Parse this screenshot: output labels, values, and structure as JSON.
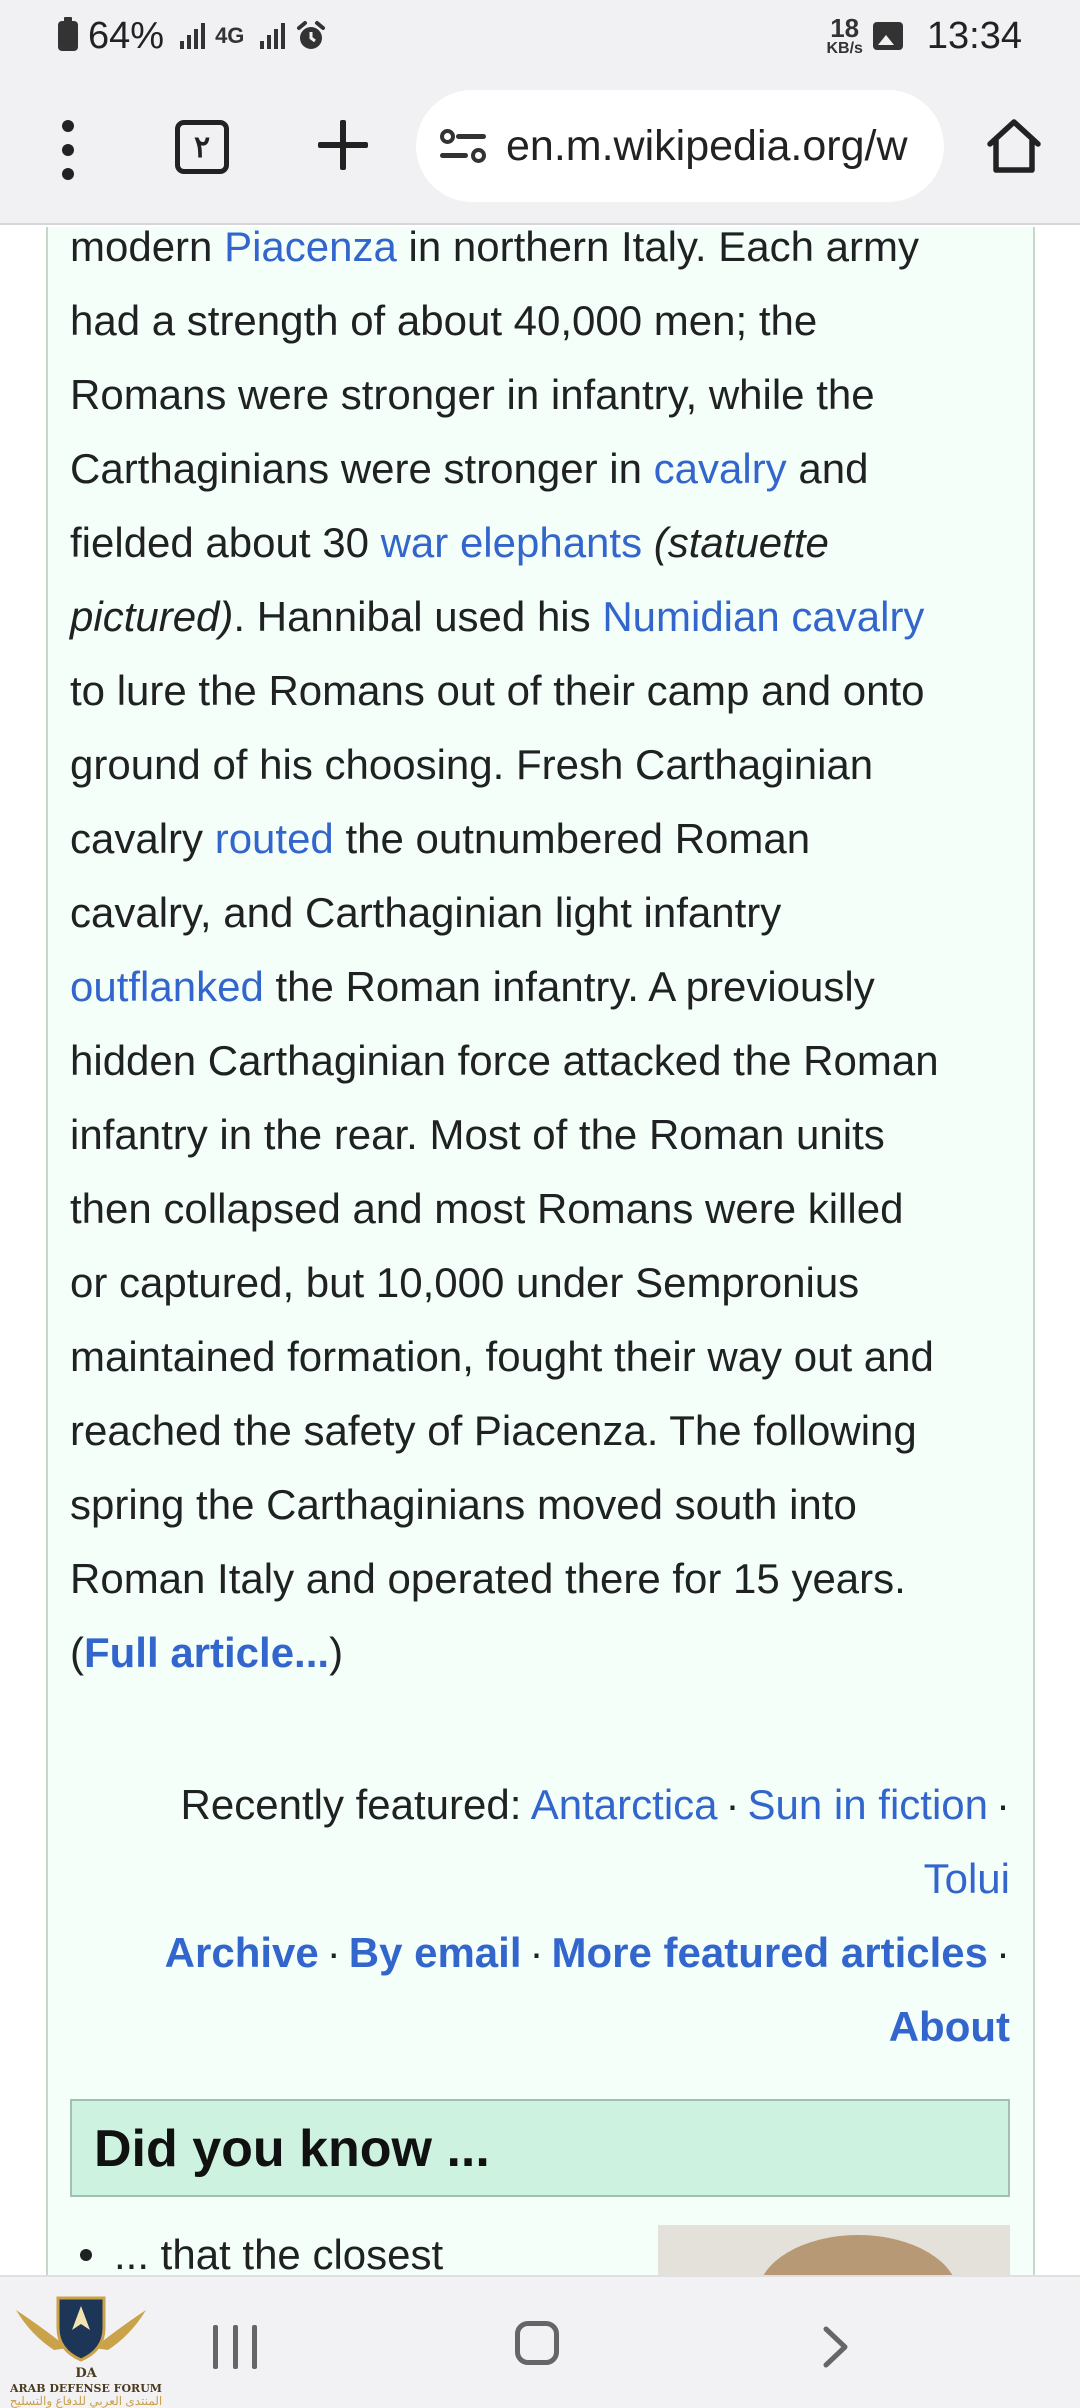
{
  "status_bar": {
    "battery": "64%",
    "network": "4G",
    "speed_value": "18",
    "speed_unit": "KB/s",
    "time": "13:34"
  },
  "browser": {
    "tab_count": "٢",
    "url": "en.m.wikipedia.org/w"
  },
  "featured_article": {
    "lines": [
      [
        {
          "t": "modern "
        },
        {
          "t": "Piacenza",
          "link": true
        },
        {
          "t": " in northern Italy. Each army"
        }
      ],
      [
        {
          "t": "had a strength of about 40,000 men; the"
        }
      ],
      [
        {
          "t": "Romans were stronger in infantry, while the"
        }
      ],
      [
        {
          "t": "Carthaginians were stronger in "
        },
        {
          "t": "cavalry",
          "link": true
        },
        {
          "t": " and"
        }
      ],
      [
        {
          "t": "fielded about 30 "
        },
        {
          "t": "war elephants",
          "link": true
        },
        {
          "t": " "
        },
        {
          "t": "(statuette",
          "italic": true
        }
      ],
      [
        {
          "t": "pictured)",
          "italic": true
        },
        {
          "t": ". Hannibal used his "
        },
        {
          "t": "Numidian cavalry",
          "link": true
        }
      ],
      [
        {
          "t": "to lure the Romans out of their camp and onto"
        }
      ],
      [
        {
          "t": "ground of his choosing. Fresh Carthaginian"
        }
      ],
      [
        {
          "t": "cavalry "
        },
        {
          "t": "routed",
          "link": true
        },
        {
          "t": " the outnumbered Roman"
        }
      ],
      [
        {
          "t": "cavalry, and Carthaginian light infantry"
        }
      ],
      [
        {
          "t": "outflanked",
          "link": true
        },
        {
          "t": " the Roman infantry. A previously"
        }
      ],
      [
        {
          "t": "hidden Carthaginian force attacked the Roman"
        }
      ],
      [
        {
          "t": "infantry in the rear. Most of the Roman units"
        }
      ],
      [
        {
          "t": "then collapsed and most Romans were killed"
        }
      ],
      [
        {
          "t": "or captured, but 10,000 under Sempronius"
        }
      ],
      [
        {
          "t": "maintained formation, fought their way out and"
        }
      ],
      [
        {
          "t": "reached the safety of Piacenza. The following"
        }
      ],
      [
        {
          "t": "spring the Carthaginians moved south into"
        }
      ],
      [
        {
          "t": "Roman Italy and operated there for 15 years."
        }
      ],
      [
        {
          "t": "("
        },
        {
          "t": "Full article...",
          "link": true,
          "bold": true
        },
        {
          "t": ")"
        }
      ]
    ],
    "recently_featured_label": "Recently featured: ",
    "recently_featured": [
      "Antarctica",
      "Sun in fiction",
      "Tolui"
    ],
    "footer_links": [
      "Archive",
      "By email",
      "More featured articles",
      "About"
    ],
    "separator": "·"
  },
  "did_you_know": {
    "title": "Did you know ...",
    "first_item": "... that the closest"
  },
  "watermark": {
    "initials": "DA",
    "name": "ARAB DEFENSE FORUM",
    "arabic": "المنتدى العربي للدفاع والتسليح"
  },
  "colors": {
    "link": "#3366cc",
    "text": "#202122",
    "featured_background": "#f5fffa",
    "dyk_header_background": "#cef2e0"
  }
}
